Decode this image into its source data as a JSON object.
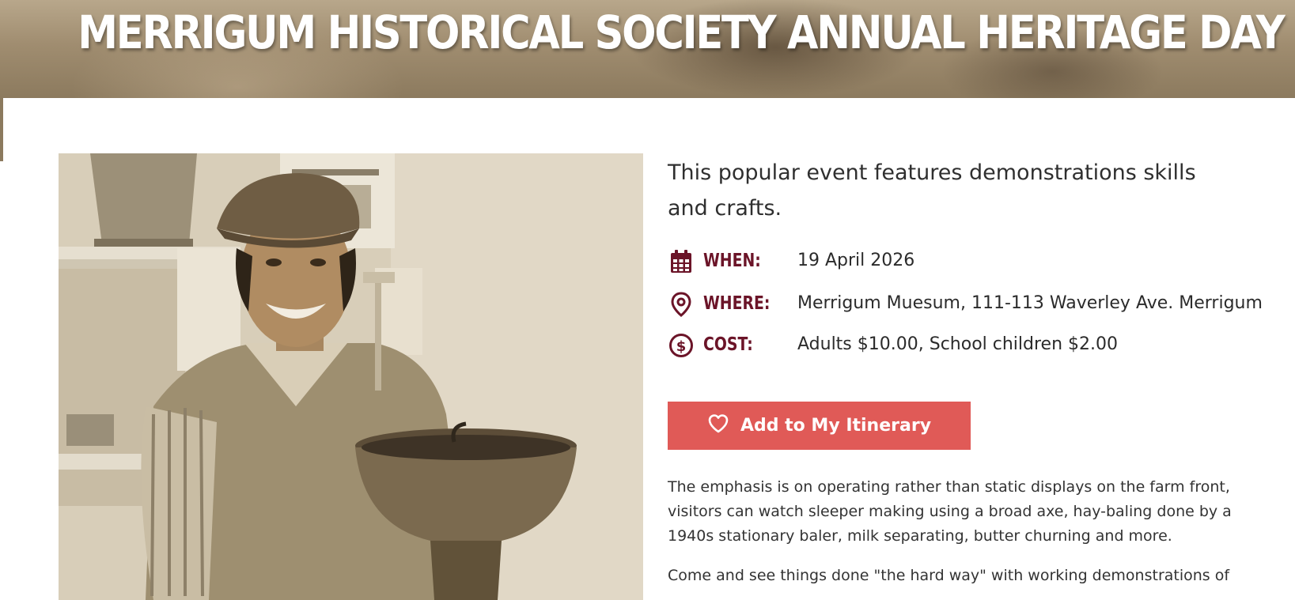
{
  "banner": {
    "title": "MERRIGUM HISTORICAL SOCIETY ANNUAL HERITAGE DAY"
  },
  "photo": {
    "subject": "man-in-cap-with-cream-separator"
  },
  "event": {
    "intro": "This popular event features demonstrations skills and crafts.",
    "when_label": "WHEN:",
    "when_value": "19 April 2026",
    "where_label": "WHERE:",
    "where_value": "Merrigum Muesum, 111-113 Waverley Ave. Merrigum",
    "cost_label": "COST:",
    "cost_value": "Adults $10.00, School children $2.00"
  },
  "actions": {
    "itinerary_label": "Add to My Itinerary"
  },
  "description": {
    "paragraph_1": "The emphasis is on operating rather than static displays on the farm front, visitors can watch sleeper making using a broad axe, hay-baling done by a 1940s stationary baler, milk separating, butter churning and more.",
    "paragraph_2": "Come and see things done \"the hard way\" with working demonstrations of"
  },
  "icons": {
    "when": "calendar-icon",
    "where": "map-pin-icon",
    "cost": "dollar-circle-icon",
    "itinerary": "heart-icon"
  },
  "colors": {
    "label_maroon": "#6b1428",
    "button_red": "#e05a57",
    "text": "#2b2b2b",
    "banner_sepia": "#a08d70"
  }
}
